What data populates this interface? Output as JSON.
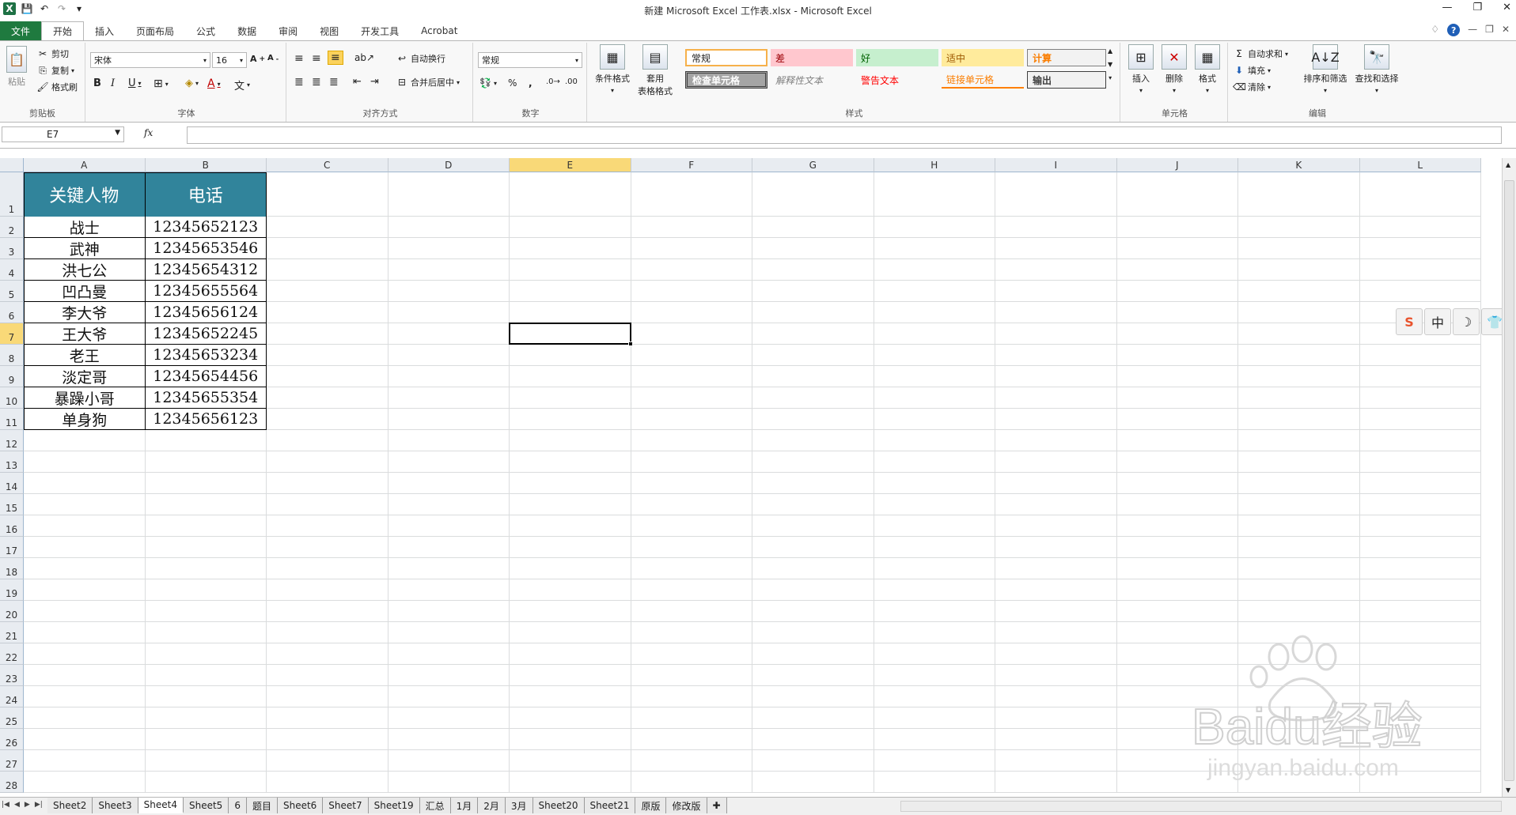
{
  "window": {
    "title": "新建 Microsoft Excel 工作表.xlsx - Microsoft Excel"
  },
  "tabs": [
    "文件",
    "开始",
    "插入",
    "页面布局",
    "公式",
    "数据",
    "审阅",
    "视图",
    "开发工具",
    "Acrobat"
  ],
  "active_tab": "开始",
  "ribbon": {
    "clipboard": {
      "paste": "粘贴",
      "cut": "剪切",
      "copy": "复制",
      "format_painter": "格式刷",
      "label": "剪贴板"
    },
    "font": {
      "name": "宋体",
      "size": "16",
      "label": "字体"
    },
    "alignment": {
      "wrap": "自动换行",
      "merge": "合并后居中",
      "label": "对齐方式"
    },
    "number": {
      "format": "常规",
      "label": "数字"
    },
    "styles": {
      "conditional": "条件格式",
      "table_format_line1": "套用",
      "table_format_line2": "表格格式",
      "cells": [
        "常规",
        "差",
        "好",
        "适中",
        "计算",
        "检查单元格",
        "解释性文本",
        "警告文本",
        "链接单元格",
        "输出"
      ],
      "label": "样式"
    },
    "cells": {
      "insert": "插入",
      "delete": "删除",
      "format": "格式",
      "label": "单元格"
    },
    "editing": {
      "autosum": "自动求和",
      "fill": "填充",
      "clear": "清除",
      "sort": "排序和筛选",
      "find": "查找和选择",
      "label": "编辑"
    }
  },
  "formula_bar": {
    "name_box": "E7",
    "fx": "fx",
    "formula": ""
  },
  "columns": [
    "A",
    "B",
    "C",
    "D",
    "E",
    "F",
    "G",
    "H",
    "I",
    "J",
    "K",
    "L"
  ],
  "selected_column": "E",
  "selected_row": 7,
  "rows": [
    "1",
    "2",
    "3",
    "4",
    "5",
    "6",
    "7",
    "8",
    "9",
    "10",
    "11",
    "12",
    "13",
    "14",
    "15",
    "16",
    "17",
    "18",
    "19",
    "20",
    "21",
    "22",
    "23",
    "24",
    "25",
    "26",
    "27",
    "28"
  ],
  "table": {
    "headers": [
      "关键人物",
      "电话"
    ],
    "rows": [
      [
        "战士",
        "12345652123"
      ],
      [
        "武神",
        "12345653546"
      ],
      [
        "洪七公",
        "12345654312"
      ],
      [
        "凹凸曼",
        "12345655564"
      ],
      [
        "李大爷",
        "12345656124"
      ],
      [
        "王大爷",
        "12345652245"
      ],
      [
        "老王",
        "12345653234"
      ],
      [
        "淡定哥",
        "12345654456"
      ],
      [
        "暴躁小哥",
        "12345655354"
      ],
      [
        "单身狗",
        "12345656123"
      ]
    ],
    "header_color": "#31849b"
  },
  "ime_toolbar": [
    "S",
    "中",
    "☽",
    "👕"
  ],
  "sheets": [
    "Sheet2",
    "Sheet3",
    "Sheet4",
    "Sheet5",
    "6",
    "题目",
    "Sheet6",
    "Sheet7",
    "Sheet19",
    "汇总",
    "1月",
    "2月",
    "3月",
    "Sheet20",
    "Sheet21",
    "原版",
    "修改版"
  ],
  "active_sheet": "Sheet4",
  "watermark": {
    "brand": "Baidu经验",
    "url": "jingyan.baidu.com"
  }
}
